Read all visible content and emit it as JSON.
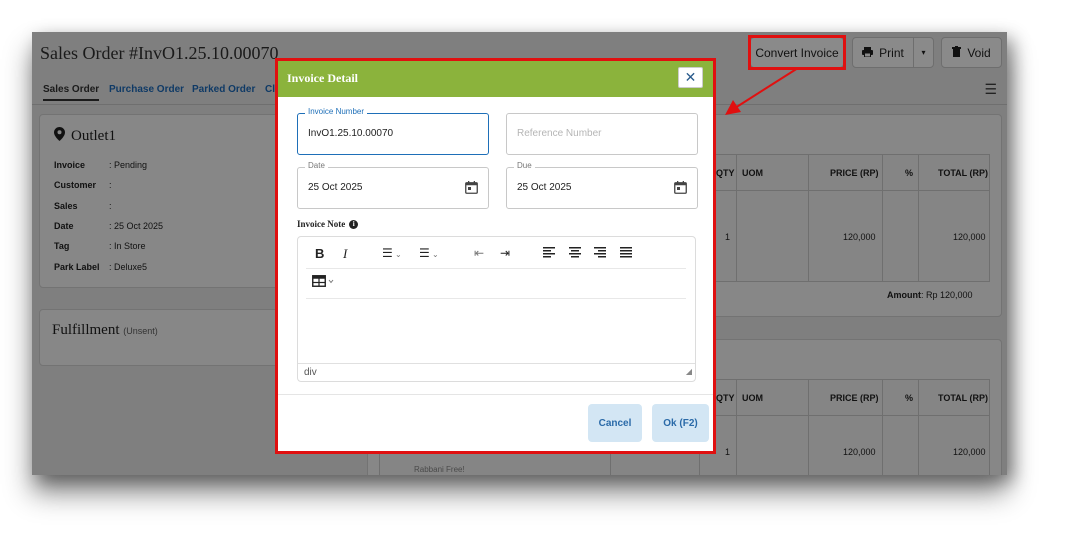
{
  "header": {
    "title": "Sales Order #InvO1.25.10.00070",
    "convert_label": "Convert Invoice",
    "print_label": "Print",
    "void_label": "Void"
  },
  "tabs": [
    "Sales Order",
    "Purchase Order",
    "Parked Order",
    "Cl"
  ],
  "outlet": {
    "name": "Outlet1",
    "rows": [
      {
        "label": "Invoice",
        "value": ": Pending"
      },
      {
        "label": "Customer",
        "value": ":"
      },
      {
        "label": "Sales",
        "value": ":"
      },
      {
        "label": "Date",
        "value": ": 25 Oct 2025"
      },
      {
        "label": "Tag",
        "value": ": In Store"
      },
      {
        "label": "Park Label",
        "value": ": Deluxe5"
      }
    ]
  },
  "fulfillment": {
    "title": "Fulfillment",
    "status": "(Unsent)"
  },
  "table1": {
    "headers": [
      "QTY",
      "UOM",
      "PRICE (RP)",
      "%",
      "TOTAL (RP)"
    ],
    "row": {
      "qty": "1",
      "price": "120,000",
      "total": "120,000"
    },
    "amount_label": "Amount",
    "amount_value": ":  Rp  120,000"
  },
  "table2": {
    "headers": [
      "QTY",
      "UOM",
      "PRICE (RP)",
      "%",
      "TOTAL (RP)"
    ],
    "row": {
      "qty": "1",
      "price": "120,000",
      "total": "120,000"
    },
    "partial_text": "Rabbani Free!"
  },
  "modal": {
    "title": "Invoice Detail",
    "close_symbol": "✕",
    "invoice_number_label": "Invoice Number",
    "invoice_number_value": "InvO1.25.10.00070",
    "reference_placeholder": "Reference Number",
    "date_label": "Date",
    "date_value": "25 Oct 2025",
    "due_label": "Due",
    "due_value": "25 Oct 2025",
    "note_label": "Invoice Note",
    "editor_status": "div",
    "cancel_label": "Cancel",
    "ok_label": "Ok (F2)"
  },
  "colors": {
    "modal_header": "#8bb33c",
    "highlight": "#e01010",
    "link": "#0f3a66"
  }
}
